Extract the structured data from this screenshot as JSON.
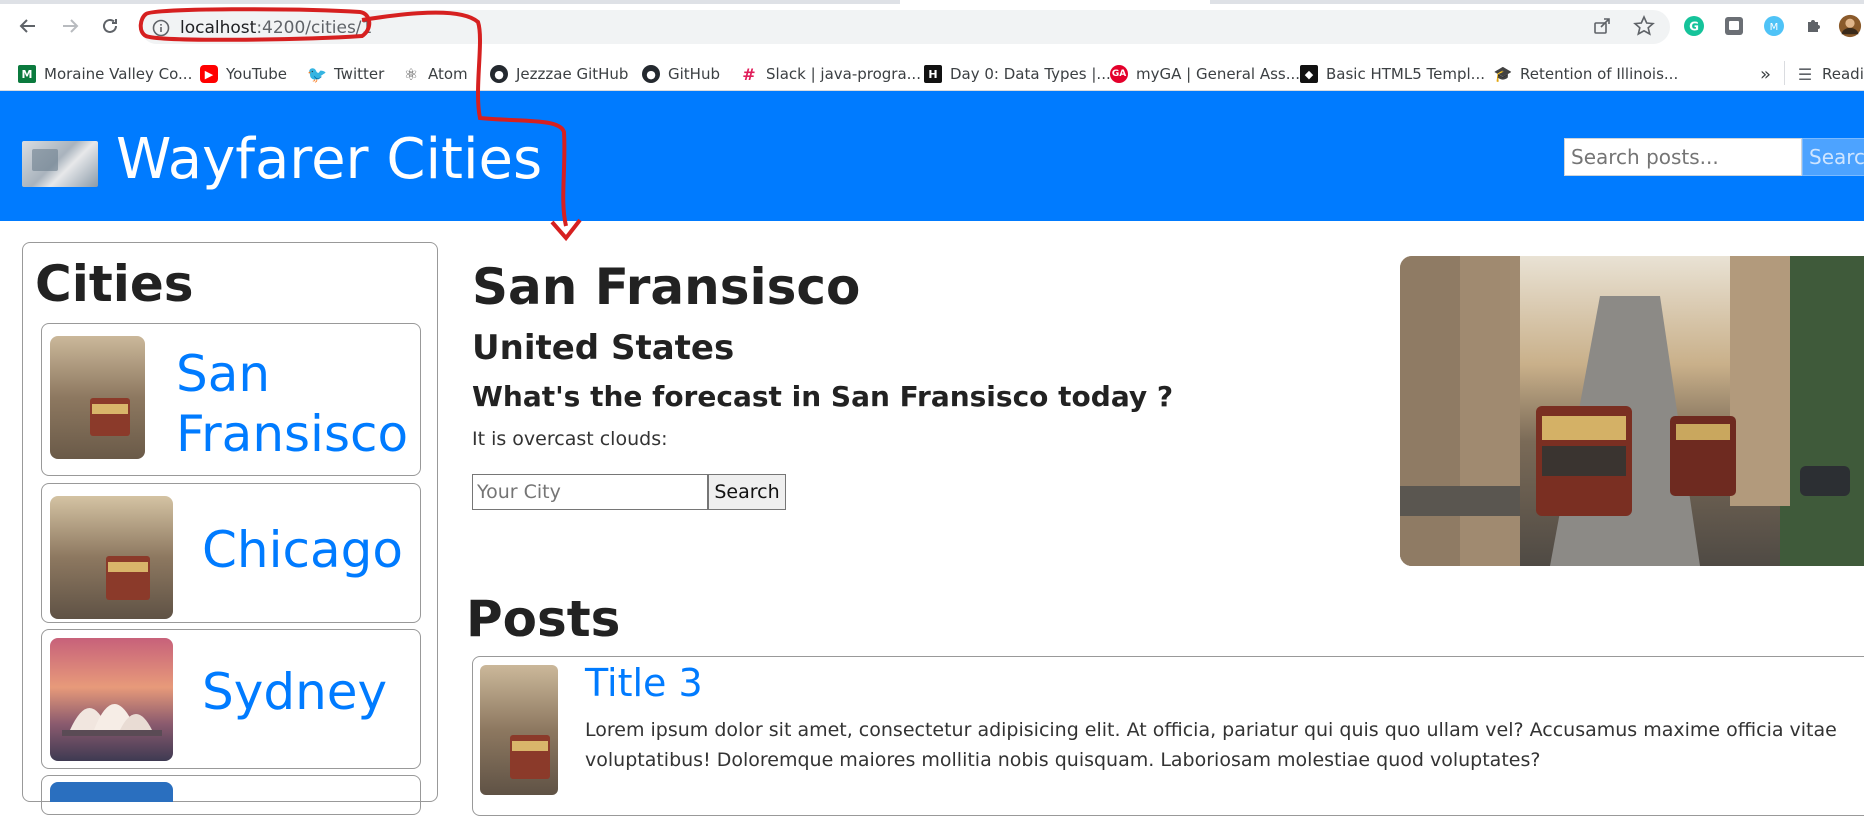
{
  "browser": {
    "url_host": "localhost",
    "url_path": ":4200/cities/1",
    "bookmarks": [
      {
        "label": "Moraine Valley Co...",
        "icon": "moraine-valley-favicon",
        "color": "#0b7a3e"
      },
      {
        "label": "YouTube",
        "icon": "youtube-favicon",
        "color": "#ff0000"
      },
      {
        "label": "Twitter",
        "icon": "twitter-favicon",
        "color": "#1d9bf0"
      },
      {
        "label": "Atom",
        "icon": "atom-favicon",
        "color": "#555555"
      },
      {
        "label": "Jezzzae GitHub",
        "icon": "github-favicon",
        "color": "#24292f"
      },
      {
        "label": "GitHub",
        "icon": "github-favicon",
        "color": "#24292f"
      },
      {
        "label": "Slack | java-progra...",
        "icon": "slack-favicon",
        "color": "#e01e5a"
      },
      {
        "label": "Day 0: Data Types |...",
        "icon": "hackerrank-favicon",
        "color": "#111111"
      },
      {
        "label": "myGA | General Ass...",
        "icon": "ga-favicon",
        "color": "#e4002b"
      },
      {
        "label": "Basic HTML5 Templ...",
        "icon": "codepen-favicon",
        "color": "#111111"
      },
      {
        "label": "Retention of Illinois...",
        "icon": "graduation-favicon",
        "color": "#17a2b8"
      }
    ],
    "overflow_label": "»",
    "reading_list_label": "Readi"
  },
  "navbar": {
    "brand_title": "Wayfarer Cities",
    "search_placeholder": "Search posts...",
    "search_button_label": "Search",
    "accent": "#007bff"
  },
  "sidebar": {
    "title": "Cities",
    "cities": [
      {
        "name_line1": "San",
        "name_line2": "Fransisco"
      },
      {
        "name": "Chicago"
      },
      {
        "name": "Sydney"
      }
    ]
  },
  "main": {
    "city": "San Fransisco",
    "country": "United States",
    "forecast_question": "What's the forecast in San Fransisco today ?",
    "weather_text": "It is overcast clouds:",
    "city_input_placeholder": "Your City",
    "search_button_label": "Search"
  },
  "posts": {
    "heading": "Posts",
    "items": [
      {
        "title": "Title 3",
        "body": "Lorem ipsum dolor sit amet, consectetur adipisicing elit. At officia, pariatur qui quis quo ullam vel? Accusamus maxime officia vitae voluptatibus! Doloremque maiores mollitia nobis quisquam. Laboriosam molestiae quod voluptates?"
      }
    ]
  }
}
